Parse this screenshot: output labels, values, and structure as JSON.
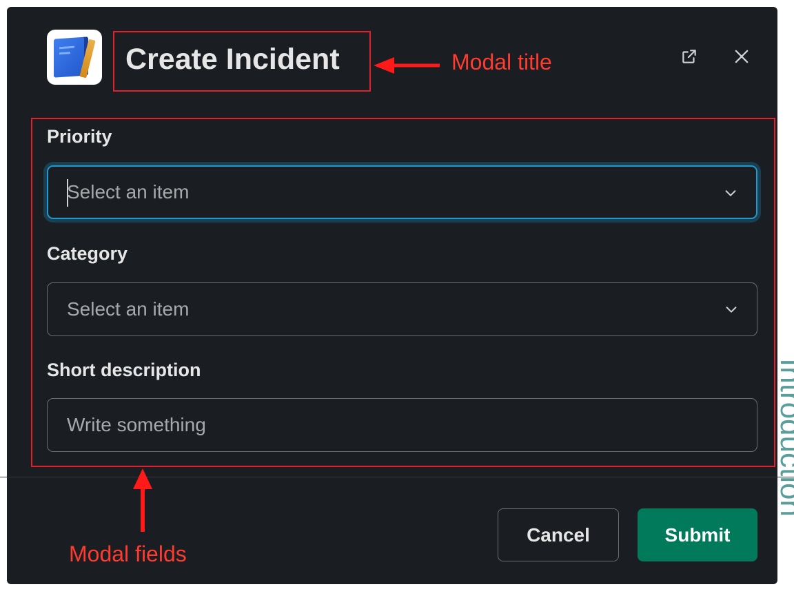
{
  "modal": {
    "title": "Create Incident",
    "app_icon": "notebook-pencil-icon",
    "popout_icon": "popout-icon",
    "close_icon": "close-icon"
  },
  "fields": [
    {
      "label": "Priority",
      "placeholder": "Select an item",
      "type": "select",
      "focused": true
    },
    {
      "label": "Category",
      "placeholder": "Select an item",
      "type": "select",
      "focused": false
    },
    {
      "label": "Short description",
      "placeholder": "Write something",
      "type": "text",
      "focused": false
    }
  ],
  "footer": {
    "cancel_label": "Cancel",
    "submit_label": "Submit"
  },
  "annotations": {
    "title_note": "Modal title",
    "fields_note": "Modal fields",
    "color": "#e0202a"
  },
  "background_text": "Introduction",
  "colors": {
    "modal_bg": "#1a1d21",
    "focus_border": "#1d9bd1",
    "submit_bg": "#007a5a"
  }
}
